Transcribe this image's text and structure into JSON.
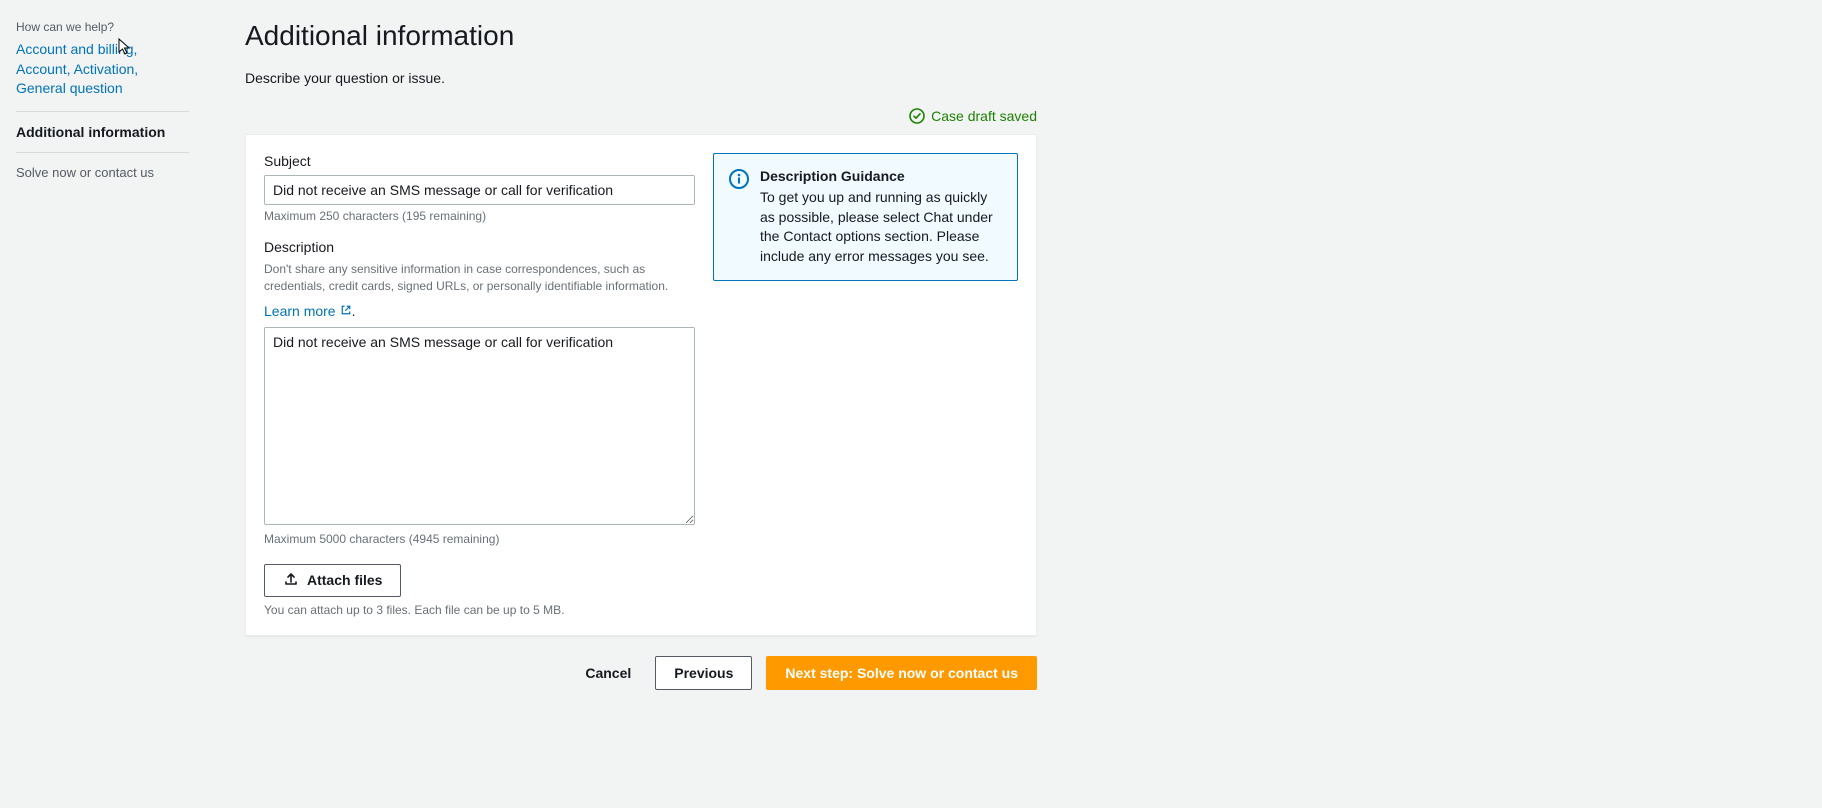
{
  "sidebar": {
    "title": "How can we help?",
    "breadcrumb_link": "Account and billing, Account, Activation, General question",
    "active_step": "Additional information",
    "next_step": "Solve now or contact us"
  },
  "page": {
    "title": "Additional information",
    "subtitle": "Describe your question or issue.",
    "draft_saved": "Case draft saved"
  },
  "form": {
    "subject_label": "Subject",
    "subject_value": "Did not receive an SMS message or call for verification",
    "subject_help": "Maximum 250 characters (195 remaining)",
    "description_label": "Description",
    "description_note": "Don't share any sensitive information in case correspondences, such as credentials, credit cards, signed URLs, or personally identifiable information.",
    "learn_more": "Learn more",
    "description_value": "Did not receive an SMS message or call for verification",
    "description_help": "Maximum 5000 characters (4945 remaining)",
    "attach_label": "Attach files",
    "attach_help": "You can attach up to 3 files. Each file can be up to 5 MB."
  },
  "guidance": {
    "title": "Description Guidance",
    "text": "To get you up and running as quickly as possible, please select Chat under the Contact options section. Please include any error messages you see."
  },
  "footer": {
    "cancel": "Cancel",
    "previous": "Previous",
    "next": "Next step: Solve now or contact us"
  }
}
